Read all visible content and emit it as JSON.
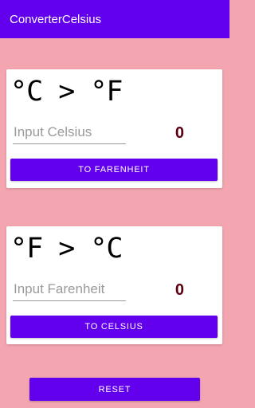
{
  "app_bar": {
    "title": "ConverterCelsius"
  },
  "celsius_card": {
    "title": "°C > °F",
    "input_placeholder": "Input Celsius",
    "input_value": "",
    "result": "0",
    "button_label": "TO FARENHEIT"
  },
  "fahrenheit_card": {
    "title": "°F > °C",
    "input_placeholder": "Input Farenheit",
    "input_value": "",
    "result": "0",
    "button_label": "TO CELSIUS"
  },
  "reset_button": {
    "label": "RESET"
  },
  "colors": {
    "background": "#f4a6b0",
    "primary": "#6200ee",
    "result_text": "#5c0011"
  }
}
